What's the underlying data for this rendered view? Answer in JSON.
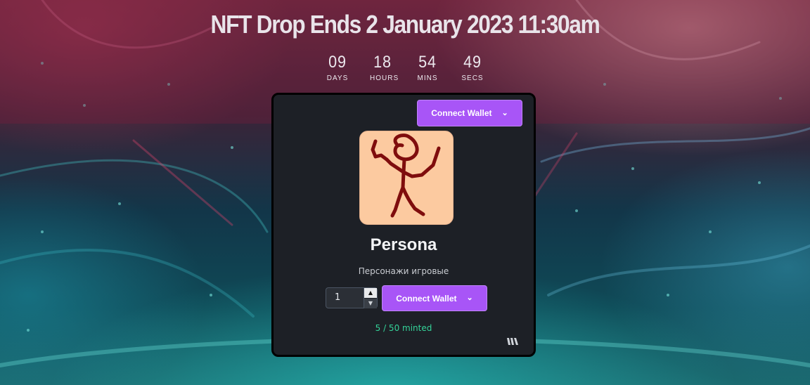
{
  "headline": "NFT Drop Ends 2 January 2023 11:30am",
  "countdown": [
    {
      "value": "09",
      "label": "DAYS"
    },
    {
      "value": "18",
      "label": "HOURS"
    },
    {
      "value": "54",
      "label": "MINS"
    },
    {
      "value": "49",
      "label": "SECS"
    }
  ],
  "card": {
    "connect_wallet_top": "Connect Wallet",
    "image_icon": "stick-figure-art",
    "nft_name": "Persona",
    "nft_description": "Персонажи игровые",
    "quantity": "1",
    "connect_wallet_mint": "Connect Wallet",
    "minted_status": "5 / 50 minted",
    "brand_icon": "thirdweb-logo-icon"
  },
  "colors": {
    "accent": "#a855f7",
    "card_bg": "#1d2026",
    "minted_text": "#34d399",
    "nft_bg": "#fccaa0",
    "figure": "#7f0d0d"
  }
}
